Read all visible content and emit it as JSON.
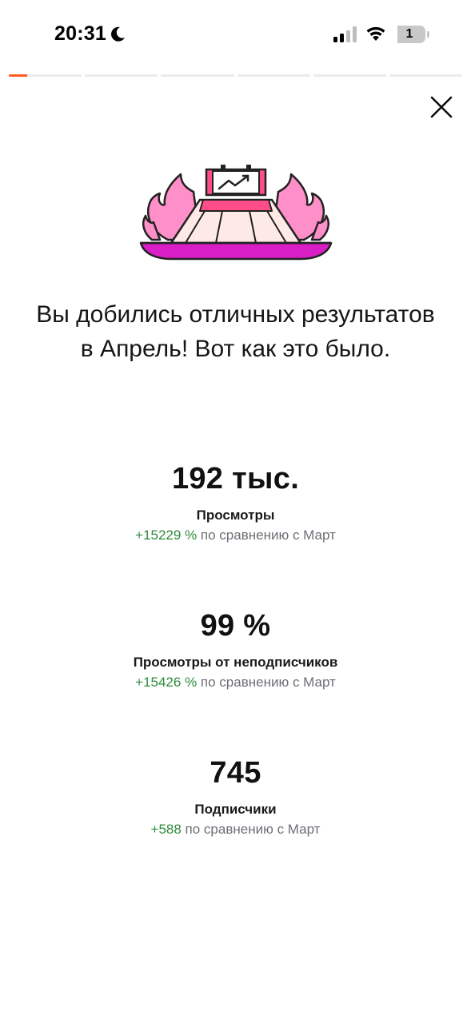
{
  "status_bar": {
    "time": "20:31",
    "battery_level": "1"
  },
  "story_progress": {
    "segments": 6,
    "active_index": 0,
    "active_fill": 0.25,
    "color": "#ff5a1f"
  },
  "close_icon": "close-icon",
  "headline": "Вы добились отличных результатов в Апрель! Вот как это было.",
  "stats": [
    {
      "value": "192 тыс.",
      "label": "Просмотры",
      "delta": "+15229 %",
      "compare": "по сравнению с Март"
    },
    {
      "value": "99 %",
      "label": "Просмотры от неподписчиков",
      "delta": "+15426 %",
      "compare": "по сравнению с Март"
    },
    {
      "value": "745",
      "label": "Подписчики",
      "delta": "+588",
      "compare": "по сравнению с Март"
    }
  ],
  "colors": {
    "accent": "#ff5a1f",
    "positive": "#2e8b3a",
    "flame": "#ff8fc8",
    "base": "#d81ec4"
  }
}
